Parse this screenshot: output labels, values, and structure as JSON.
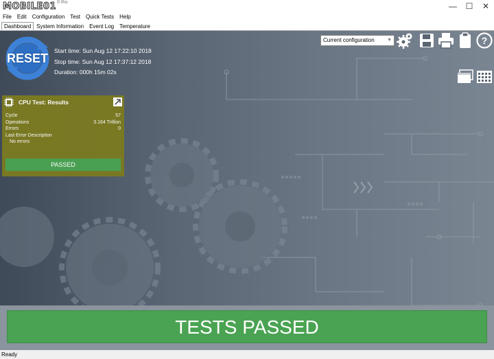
{
  "app": {
    "logo_text": "MOBILE01",
    "logo_sub": "© Pro"
  },
  "window_buttons": {
    "minimize": "—",
    "maximize": "☐",
    "close": "✕"
  },
  "menu": [
    "File",
    "Edit",
    "Configuration",
    "Test",
    "Quick Tests",
    "Help"
  ],
  "tabs": [
    {
      "label": "Dashboard",
      "active": true
    },
    {
      "label": "System Information",
      "active": false
    },
    {
      "label": "Event Log",
      "active": false
    },
    {
      "label": "Temperature",
      "active": false
    }
  ],
  "reset": {
    "label": "RESET",
    "icon": "refresh-arrows-icon"
  },
  "times": {
    "start": "Start time: Sun Aug 12 17:22:10 2018",
    "stop": "Stop time: Sun Aug 12 17:37:12 2018",
    "duration": "Duration: 000h 15m 02s"
  },
  "config": {
    "selected": "Current configuration"
  },
  "toolbar_icons": [
    "gears-icon",
    "save-icon",
    "print-icon",
    "clipboard-icon",
    "help-icon"
  ],
  "view_icons": [
    "window-view-icon",
    "grid-view-icon"
  ],
  "cpu_panel": {
    "title": "CPU Test: Results",
    "rows": [
      {
        "label": "Cycle",
        "value": "57"
      },
      {
        "label": "Operations",
        "value": "3.164 Trillion"
      },
      {
        "label": "Errors",
        "value": "0"
      },
      {
        "label": "Last Error Description",
        "value": ""
      }
    ],
    "error_desc": "No errors",
    "status": "PASSED"
  },
  "banner": "TESTS PASSED",
  "status_bar": "Ready",
  "colors": {
    "passed_green": "#4aa352",
    "panel_olive": "#7b7a22",
    "reset_blue": "#2e6fc4"
  }
}
